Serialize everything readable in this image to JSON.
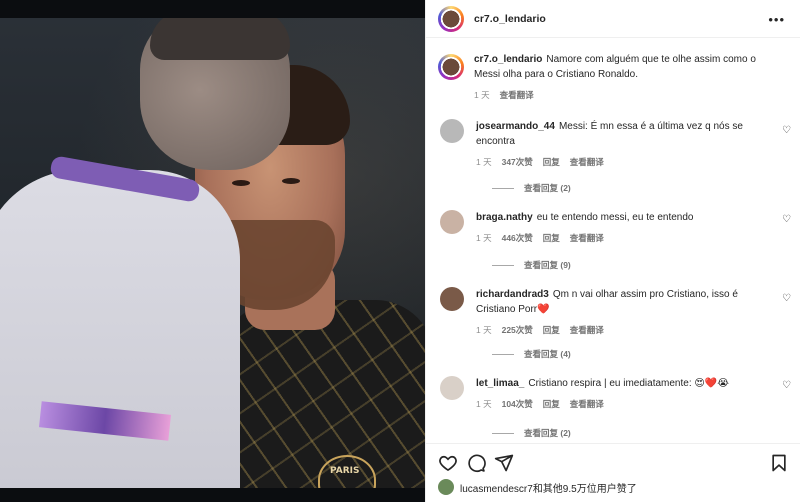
{
  "post": {
    "username": "cr7.o_lendario",
    "more_icon": "more-horizontal-icon"
  },
  "caption": {
    "username": "cr7.o_lendario",
    "text": "Namore com alguém que te olhe assim como o Messi olha para o Cristiano Ronaldo.",
    "time": "1 天",
    "translate": "查看翻译"
  },
  "comments": [
    {
      "username": "josearmando_44",
      "text": "Messi: É mn essa é a última vez q nós se encontra",
      "time": "1 天",
      "likes": "347次赞",
      "reply": "回复",
      "translate": "查看翻译",
      "view_replies": "查看回复 (2)",
      "avatar_color": "#b8b8b8"
    },
    {
      "username": "braga.nathy",
      "text": "eu te entendo messi, eu te entendo",
      "time": "1 天",
      "likes": "446次赞",
      "reply": "回复",
      "translate": "查看翻译",
      "view_replies": "查看回复 (9)",
      "avatar_color": "#c9b2a4"
    },
    {
      "username": "richardandrad3",
      "text": "Qm n vai olhar assim pro Cristiano, isso é Cristiano Porr❤️",
      "time": "1 天",
      "likes": "225次赞",
      "reply": "回复",
      "translate": "查看翻译",
      "view_replies": "查看回复 (4)",
      "avatar_color": "#7a5a48"
    },
    {
      "username": "let_limaa_",
      "text": "Cristiano respira | eu imediatamente: 😍❤️😭",
      "time": "1 天",
      "likes": "104次赞",
      "reply": "回复",
      "translate": "查看翻译",
      "view_replies": "查看回复 (2)",
      "avatar_color": "#d9d0c8"
    }
  ],
  "actions": {
    "like_icon": "heart-icon",
    "comment_icon": "comment-icon",
    "share_icon": "send-icon",
    "save_icon": "bookmark-icon"
  },
  "likes_line": {
    "text": "lucasmendescr7和其他9.5万位用户赞了"
  },
  "photo": {
    "crest_text": "PARIS"
  },
  "colors": {
    "text": "#262626",
    "muted": "#8e8e8e",
    "border": "#efefef"
  }
}
